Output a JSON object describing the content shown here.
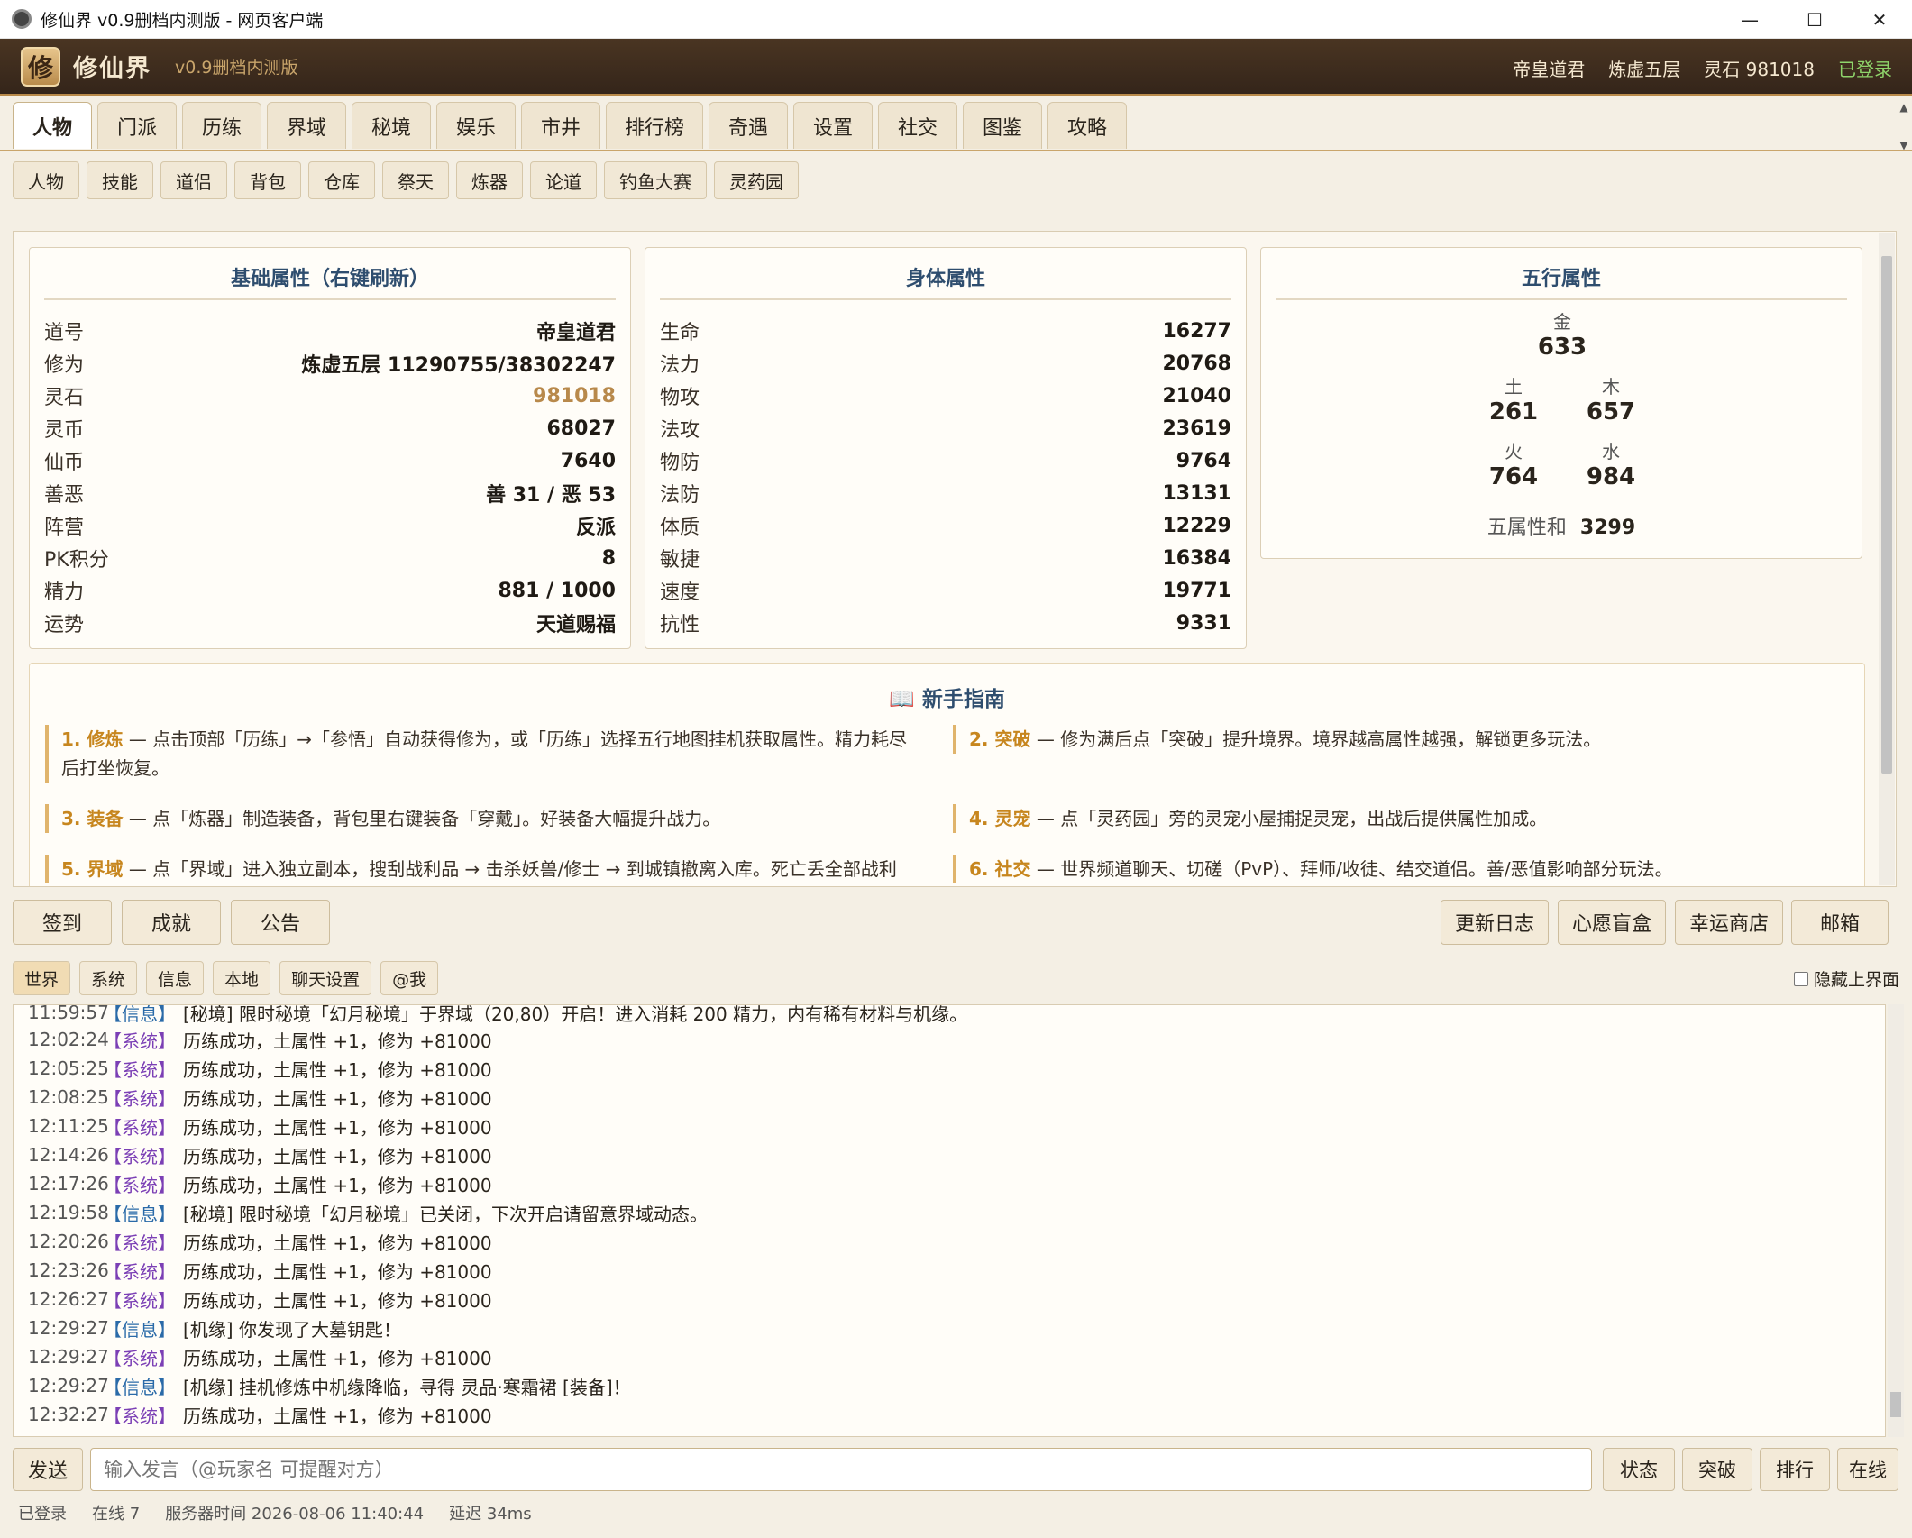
{
  "window": {
    "title": "修仙界 v0.9删档内测版 - 网页客户端",
    "minimize": "—",
    "maximize": "☐",
    "close": "✕"
  },
  "header": {
    "logo": "修",
    "brand": "修仙界",
    "version": "v0.9删档内测版",
    "player": "帝皇道君",
    "realm": "炼虚五层",
    "spirit_stone": "灵石 981018",
    "login": "已登录"
  },
  "main_tabs": [
    "人物",
    "门派",
    "历练",
    "界域",
    "秘境",
    "娱乐",
    "市井",
    "排行榜",
    "奇遇",
    "设置",
    "社交",
    "图鉴",
    "攻略"
  ],
  "sub_tabs": [
    "人物",
    "技能",
    "道侣",
    "背包",
    "仓库",
    "祭天",
    "炼器",
    "论道",
    "钓鱼大赛",
    "灵药园"
  ],
  "basic": {
    "title": "基础属性（右键刷新）",
    "rows": [
      {
        "k": "道号",
        "v": "帝皇道君"
      },
      {
        "k": "修为",
        "v": "炼虚五层 11290755/38302247"
      },
      {
        "k": "灵石",
        "v": "981018"
      },
      {
        "k": "灵币",
        "v": "68027"
      },
      {
        "k": "仙币",
        "v": "7640"
      },
      {
        "k": "善恶",
        "v": "善 31 / 恶 53"
      },
      {
        "k": "阵营",
        "v": "反派"
      },
      {
        "k": "PK积分",
        "v": "8"
      },
      {
        "k": "精力",
        "v": "881 / 1000"
      },
      {
        "k": "运势",
        "v": "天道赐福"
      }
    ]
  },
  "body": {
    "title": "身体属性",
    "rows": [
      {
        "k": "生命",
        "v": "16277"
      },
      {
        "k": "法力",
        "v": "20768"
      },
      {
        "k": "物攻",
        "v": "21040"
      },
      {
        "k": "法攻",
        "v": "23619"
      },
      {
        "k": "物防",
        "v": "9764"
      },
      {
        "k": "法防",
        "v": "13131"
      },
      {
        "k": "体质",
        "v": "12229"
      },
      {
        "k": "敏捷",
        "v": "16384"
      },
      {
        "k": "速度",
        "v": "19771"
      },
      {
        "k": "抗性",
        "v": "9331"
      }
    ]
  },
  "wuxing": {
    "title": "五行属性",
    "metal": {
      "l": "金",
      "v": "633"
    },
    "earth": {
      "l": "土",
      "v": "261"
    },
    "wood": {
      "l": "木",
      "v": "657"
    },
    "fire": {
      "l": "火",
      "v": "764"
    },
    "water": {
      "l": "水",
      "v": "984"
    },
    "sum_label": "五属性和",
    "sum": "3299"
  },
  "guide": {
    "title": "新手指南",
    "items": [
      {
        "h": "1. 修炼",
        "t": " — 点击顶部「历练」→「参悟」自动获得修为，或「历练」选择五行地图挂机获取属性。精力耗尽",
        "t2": "后打坐恢复。"
      },
      {
        "h": "2. 突破",
        "t": " — 修为满后点「突破」提升境界。境界越高属性越强，解锁更多玩法。",
        "t2": ""
      },
      {
        "h": "3. 装备",
        "t": " — 点「炼器」制造装备，背包里右键装备「穿戴」。好装备大幅提升战力。",
        "t2": ""
      },
      {
        "h": "4. 灵宠",
        "t": " — 点「灵药园」旁的灵宠小屋捕捉灵宠，出战后提供属性加成。",
        "t2": ""
      },
      {
        "h": "5. 界域",
        "t": " — 点「界域」进入独立副本，搜刮战利品 → 击杀妖兽/修士 → 到城镇撤离入库。死亡丢全部战利",
        "t2": ""
      },
      {
        "h": "6. 社交",
        "t": " — 世界频道聊天、切磋（PvP）、拜师/收徒、结交道侣。善/恶值影响部分玩法。",
        "t2": ""
      }
    ]
  },
  "actions_left": [
    "签到",
    "成就",
    "公告"
  ],
  "actions_right": [
    "更新日志",
    "心愿盲盒",
    "幸运商店",
    "邮箱"
  ],
  "chat_tabs": [
    "世界",
    "系统",
    "信息",
    "本地",
    "聊天设置",
    "@我"
  ],
  "hide_ui": "隐藏上界面",
  "chat": [
    {
      "time": "11:59:57",
      "tag": "【信息】",
      "type": "info",
      "text": "[秘境] 限时秘境「幻月秘境」于界域（20,80）开启！进入消耗 200 精力，内有稀有材料与机缘。"
    },
    {
      "time": "12:02:24",
      "tag": "【系统】",
      "type": "sys",
      "text": "历练成功，土属性 +1，修为 +81000"
    },
    {
      "time": "12:05:25",
      "tag": "【系统】",
      "type": "sys",
      "text": "历练成功，土属性 +1，修为 +81000"
    },
    {
      "time": "12:08:25",
      "tag": "【系统】",
      "type": "sys",
      "text": "历练成功，土属性 +1，修为 +81000"
    },
    {
      "time": "12:11:25",
      "tag": "【系统】",
      "type": "sys",
      "text": "历练成功，土属性 +1，修为 +81000"
    },
    {
      "time": "12:14:26",
      "tag": "【系统】",
      "type": "sys",
      "text": "历练成功，土属性 +1，修为 +81000"
    },
    {
      "time": "12:17:26",
      "tag": "【系统】",
      "type": "sys",
      "text": "历练成功，土属性 +1，修为 +81000"
    },
    {
      "time": "12:19:58",
      "tag": "【信息】",
      "type": "info",
      "text": "[秘境] 限时秘境「幻月秘境」已关闭，下次开启请留意界域动态。"
    },
    {
      "time": "12:20:26",
      "tag": "【系统】",
      "type": "sys",
      "text": "历练成功，土属性 +1，修为 +81000"
    },
    {
      "time": "12:23:26",
      "tag": "【系统】",
      "type": "sys",
      "text": "历练成功，土属性 +1，修为 +81000"
    },
    {
      "time": "12:26:27",
      "tag": "【系统】",
      "type": "sys",
      "text": "历练成功，土属性 +1，修为 +81000"
    },
    {
      "time": "12:29:27",
      "tag": "【信息】",
      "type": "info",
      "text": "[机缘] 你发现了大墓钥匙！"
    },
    {
      "time": "12:29:27",
      "tag": "【系统】",
      "type": "sys",
      "text": "历练成功，土属性 +1，修为 +81000"
    },
    {
      "time": "12:29:27",
      "tag": "【信息】",
      "type": "info",
      "text": "[机缘] 挂机修炼中机缘降临，寻得 灵品·寒霜裙 [装备]！"
    },
    {
      "time": "12:32:27",
      "tag": "【系统】",
      "type": "sys",
      "text": "历练成功，土属性 +1，修为 +81000"
    }
  ],
  "input": {
    "send": "发送",
    "placeholder": "输入发言（@玩家名 可提醒对方）"
  },
  "input_buttons": [
    "状态",
    "突破",
    "排行",
    "在线"
  ],
  "status": {
    "login": "已登录",
    "online": "在线 7",
    "server_time": "服务器时间 2026-08-06 11:40:44",
    "latency": "延迟 34ms"
  },
  "colors": {
    "header": "#3f2d1e",
    "accent": "#c9a56b",
    "gold": "#b8894b",
    "sys": "#7b3fb5",
    "info": "#2a6aa8",
    "ok": "#8fd46b"
  }
}
